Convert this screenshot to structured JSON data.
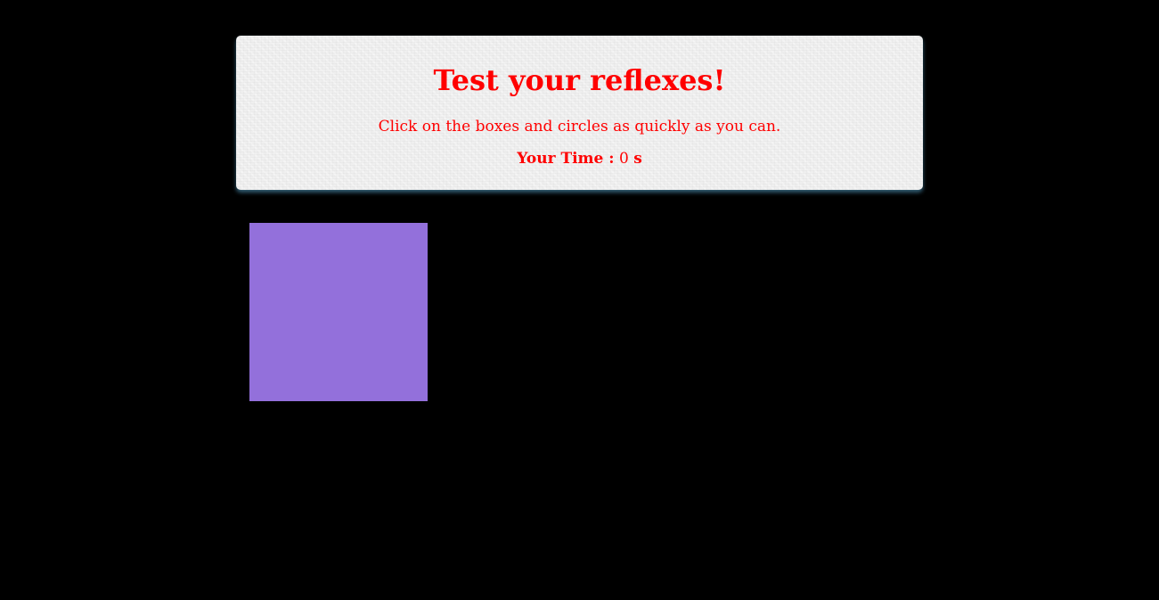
{
  "header": {
    "title": "Test your reflexes!",
    "instructions": "Click on the boxes and circles as quickly as you can.",
    "time_label": "Your Time :",
    "time_value": "0",
    "time_unit": "s"
  },
  "colors": {
    "page_background": "#000000",
    "header_text": "#ff0000",
    "header_background": "#efefef"
  },
  "game": {
    "target": {
      "shape": "square",
      "color": "#9370DB"
    }
  }
}
